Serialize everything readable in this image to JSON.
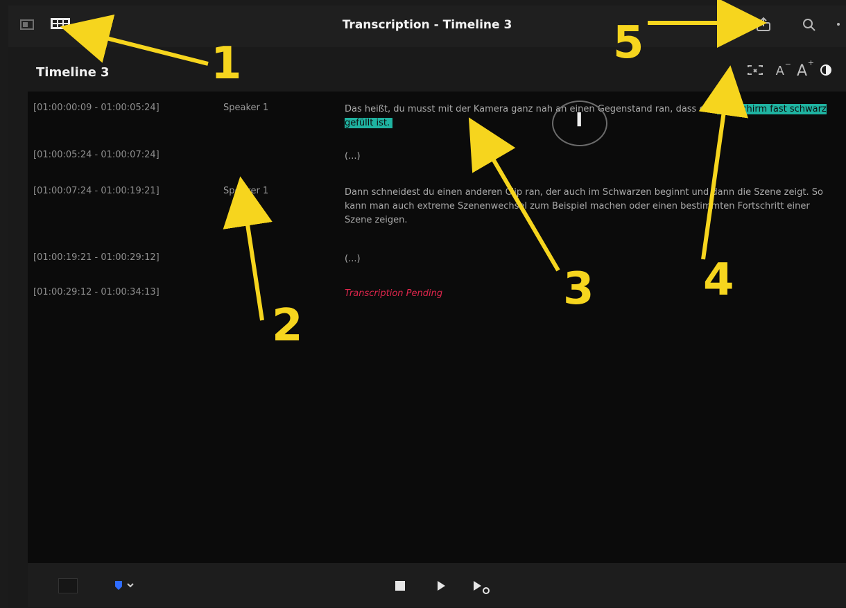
{
  "window": {
    "title": "Transcription - Timeline 3",
    "timeline_title": "Timeline 3"
  },
  "toolbar": {
    "left_icons": [
      "single-view-icon",
      "grid-view-icon"
    ],
    "right_icons": [
      "share-export-icon",
      "search-icon",
      "more-icon"
    ]
  },
  "header_tools": {
    "items": [
      {
        "name": "timecode-toggle-icon"
      },
      {
        "name": "font-decrease-icon",
        "label": "A",
        "sup": "−"
      },
      {
        "name": "font-increase-icon",
        "label": "A",
        "sup": "+"
      },
      {
        "name": "contrast-icon"
      }
    ]
  },
  "transcript": {
    "rows": [
      {
        "time": "[01:00:00:09 - 01:00:05:24]",
        "speaker": "Speaker 1",
        "text_before": "Das heißt, du musst mit der Kamera ganz nah an einen Gegenstand ran, dass der ",
        "text_highlight": "Bildschirm fast schwarz gefüllt ist.",
        "text_after": ""
      },
      {
        "time": "[01:00:05:24 - 01:00:07:24]",
        "speaker": "",
        "text": "(...)"
      },
      {
        "time": "[01:00:07:24 - 01:00:19:21]",
        "speaker": "Speaker 1",
        "text": "Dann schneidest du einen anderen Clip ran, der auch im Schwarzen beginnt und dann die Szene zeigt. So kann man auch extreme Szenenwechsel zum Beispiel machen oder einen bestimmten Fortschritt einer Szene zeigen."
      },
      {
        "time": "[01:00:19:21 - 01:00:29:12]",
        "speaker": "",
        "text": "(...)"
      },
      {
        "time": "[01:00:29:12 - 01:00:34:13]",
        "speaker": "",
        "text": "Transcription Pending"
      }
    ]
  },
  "annotations": {
    "labels": [
      "1",
      "2",
      "3",
      "4",
      "5"
    ],
    "color": "#f6d51e"
  },
  "footer": {
    "icons": [
      "panel-icon",
      "marker-flag-icon",
      "stop-icon",
      "play-icon",
      "play-loop-icon"
    ]
  }
}
